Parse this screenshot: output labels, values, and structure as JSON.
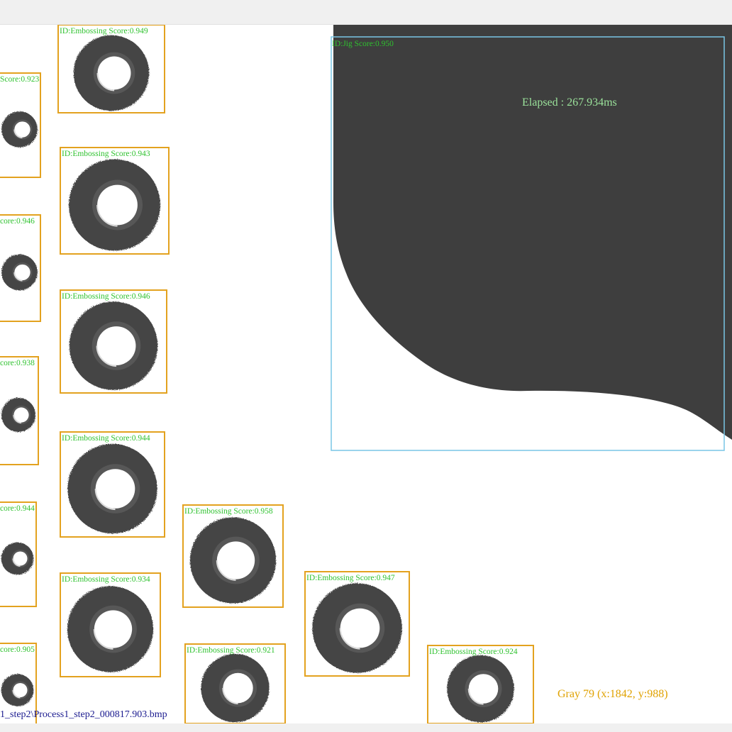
{
  "colors": {
    "roi_box": "#e3a21f",
    "jig_box": "#78c6e6",
    "label": "#2fc22f",
    "part_dark": "#3c3c3c",
    "background": "#ffffff",
    "chrome": "#f0f0f0"
  },
  "elapsed_text": "Elapsed : 267.934ms",
  "pixel_info": "Gray 79 (x:1842, y:988)",
  "file_path": "1_step2\\Process1_step2_000817.903.bmp",
  "jig": {
    "label": "ID:Jig Score:0.950"
  },
  "detections": [
    {
      "label": "ID:Embossing Score:0.949"
    },
    {
      "label": "Score:0.923"
    },
    {
      "label": "ID:Embossing Score:0.943"
    },
    {
      "label": "core:0.946"
    },
    {
      "label": "ID:Embossing Score:0.946"
    },
    {
      "label": "core:0.938"
    },
    {
      "label": "ID:Embossing Score:0.944"
    },
    {
      "label": "core:0.944"
    },
    {
      "label": "ID:Embossing Score:0.958"
    },
    {
      "label": "ID:Embossing Score:0.934"
    },
    {
      "label": "ID:Embossing Score:0.947"
    },
    {
      "label": "core:0.905"
    },
    {
      "label": "ID:Embossing Score:0.921"
    },
    {
      "label": "ID:Embossing Score:0.924"
    }
  ]
}
